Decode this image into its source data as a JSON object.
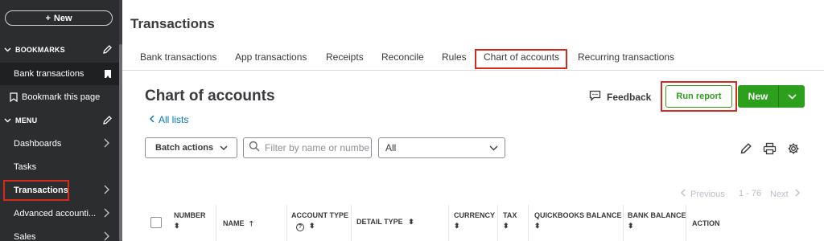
{
  "sidebar": {
    "new_label": "New",
    "bookmarks_label": "BOOKMARKS",
    "bookmark_item": "Bank transactions",
    "bookmark_this_page": "Bookmark this page",
    "menu_label": "MENU",
    "items": [
      {
        "label": "Dashboards"
      },
      {
        "label": "Tasks"
      },
      {
        "label": "Transactions"
      },
      {
        "label": "Advanced accounti..."
      },
      {
        "label": "Sales"
      }
    ]
  },
  "header": {
    "title": "Transactions"
  },
  "tabs": [
    {
      "label": "Bank transactions"
    },
    {
      "label": "App transactions"
    },
    {
      "label": "Receipts"
    },
    {
      "label": "Reconcile"
    },
    {
      "label": "Rules"
    },
    {
      "label": "Chart of accounts",
      "active": true
    },
    {
      "label": "Recurring transactions"
    }
  ],
  "main": {
    "title": "Chart of accounts",
    "back_link": "All lists",
    "feedback_label": "Feedback",
    "run_report_label": "Run report",
    "new_label": "New",
    "batch_label": "Batch actions",
    "filter_placeholder": "Filter by name or number",
    "type_select_value": "All",
    "pager": {
      "prev": "Previous",
      "range": "1 - 76",
      "next": "Next"
    }
  },
  "table": {
    "columns": [
      {
        "label": "NUMBER"
      },
      {
        "label": "NAME"
      },
      {
        "label": "ACCOUNT TYPE"
      },
      {
        "label": "DETAIL TYPE"
      },
      {
        "label": "CURRENCY"
      },
      {
        "label": "TAX"
      },
      {
        "label": "QUICKBOOKS BALANCE"
      },
      {
        "label": "BANK BALANCE"
      },
      {
        "label": "ACTION"
      }
    ]
  },
  "colors": {
    "accent_green": "#2ca01c",
    "link_blue": "#0077c5",
    "sidebar_bg": "#2b2d2f",
    "highlight_red": "#d52b1e"
  }
}
